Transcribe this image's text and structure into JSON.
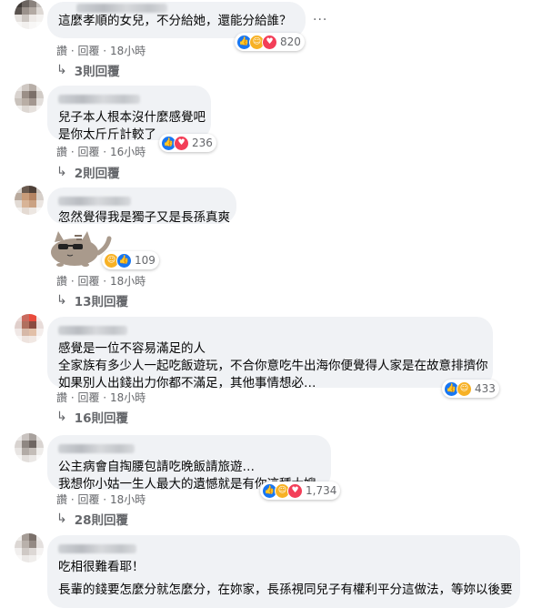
{
  "comments": [
    {
      "text": [
        "這麼孝順的女兒，不分給她，還能分給誰？"
      ],
      "reactions": [
        "like",
        "haha",
        "love"
      ],
      "count": "820",
      "actions": {
        "like": "讚",
        "dot": " · ",
        "reply": "回覆",
        "time": "18小時"
      },
      "replies": "3則回覆"
    },
    {
      "text": [
        "兒子本人根本沒什麼感覺吧",
        "是你太斤斤計較了"
      ],
      "reactions": [
        "like",
        "love"
      ],
      "count": "236",
      "actions": {
        "like": "讚",
        "dot": " · ",
        "reply": "回覆",
        "time": "16小時"
      },
      "replies": "2則回覆"
    },
    {
      "text": [
        "忽然覺得我是獨子又是長孫真爽"
      ],
      "reactions": [
        "haha",
        "like"
      ],
      "count": "109",
      "actions": {
        "like": "讚",
        "dot": " · ",
        "reply": "回覆",
        "time": "18小時"
      },
      "replies": "13則回覆"
    },
    {
      "text": [
        "感覺是一位不容易滿足的人",
        "全家族有多少人一起吃飯遊玩，不合你意吃牛出海你便覺得人家是在故意排擠你",
        "如果別人出錢出力你都不滿足，其他事情想必…"
      ],
      "reactions": [
        "like",
        "haha"
      ],
      "count": "433",
      "actions": {
        "like": "讚",
        "dot": " · ",
        "reply": "回覆",
        "time": "18小時"
      },
      "replies": "16則回覆"
    },
    {
      "text": [
        "公主病會自掏腰包請吃晚飯請旅遊…",
        "我想你小姑一生人最大的遺憾就是有你這種大嫂…"
      ],
      "reactions": [
        "like",
        "haha",
        "love"
      ],
      "count": "1,734",
      "actions": {
        "like": "讚",
        "dot": " · ",
        "reply": "回覆",
        "time": "18小時"
      },
      "replies": "28則回覆"
    },
    {
      "text": [
        "吃相很難看耶！",
        "",
        "長輩的錢要怎麼分就怎麼分，在妳家，長孫視同兒子有權利平分這做法，等妳以後要"
      ]
    }
  ],
  "icons": {
    "like": "thumbs-up-icon",
    "love": "heart-icon",
    "haha": "laughing-face-icon",
    "reply-arrow": "reply-arrow-icon",
    "more": "more-options-icon"
  },
  "colors": {
    "like": "#1877f2",
    "love": "#f33e58",
    "haha": "#f7b125",
    "bubble": "#f0f2f5",
    "meta": "#65676b"
  }
}
